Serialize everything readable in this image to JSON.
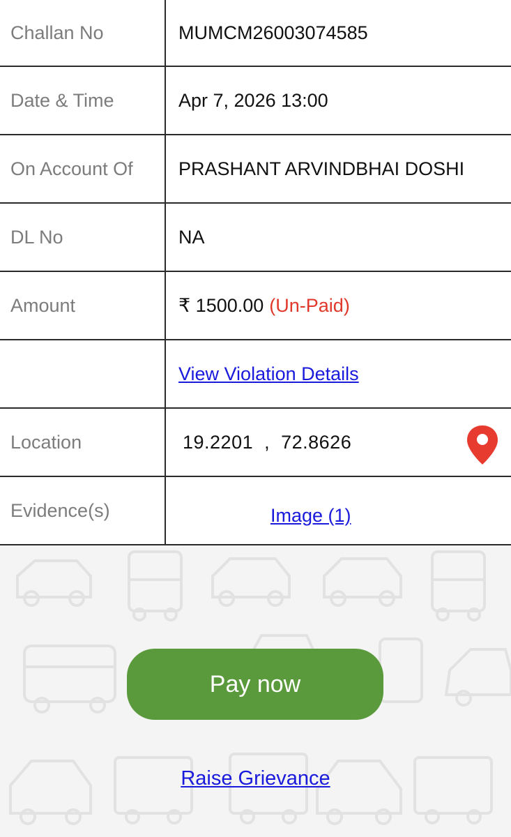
{
  "rows": [
    {
      "label": "Challan No",
      "value": "MUMCM26003074585"
    },
    {
      "label": "Date & Time",
      "value": "Apr 7, 2026 13:00"
    },
    {
      "label": "On Account Of",
      "value": "PRASHANT ARVINDBHAI DOSHI"
    },
    {
      "label": "DL No",
      "value": "NA"
    },
    {
      "label": "Amount",
      "value": "₹ 1500.00",
      "status": "(Un-Paid)"
    },
    {
      "label": "",
      "link": "View Violation Details"
    },
    {
      "label": "Location",
      "value": "19.2201  ,  72.8626"
    },
    {
      "label": "Evidence(s)",
      "link": "Image (1)"
    }
  ],
  "colors": {
    "unpaid": "#e0392b",
    "link": "#1a1adc",
    "pay_button": "#5b9a3c",
    "pin": "#e63b2e"
  },
  "icons": {
    "location": "map-pin-icon"
  },
  "actions": {
    "pay_now": "Pay now",
    "raise_grievance": "Raise Grievance"
  }
}
